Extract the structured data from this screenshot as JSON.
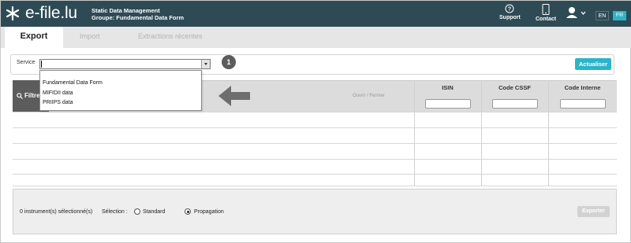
{
  "header": {
    "logo_text": "e-file.lu",
    "app_title": "Static Data Management",
    "app_group": "Groupe: Fundamental Data Form",
    "support_label": "Support",
    "contact_label": "Contact",
    "lang_en": "EN",
    "lang_fr": "FR",
    "active_language": "FR"
  },
  "tabs": [
    {
      "label": "Export",
      "active": true
    },
    {
      "label": "Import",
      "active": false
    },
    {
      "label": "Extractions récentes",
      "active": false
    }
  ],
  "service": {
    "label": "Service",
    "value": "",
    "options": [
      "Fundamental Data Form",
      "MIFIDII data",
      "PRIIPS data"
    ],
    "badge": "1",
    "refresh_label": "Actualiser"
  },
  "table": {
    "filter_label": "Filtre",
    "open_close_label": "Ouvrir / Fermer",
    "columns": [
      "ISIN",
      "Code CSSF",
      "Code Interne"
    ],
    "rows": 5
  },
  "footer": {
    "selected_text": "0 instrument(s) sélectionné(s)",
    "selection_label": "Sélection :",
    "options": [
      {
        "label": "Standard",
        "checked": false
      },
      {
        "label": "Propagation",
        "checked": true
      }
    ],
    "export_label": "Exporter"
  },
  "colors": {
    "header_bg": "#2e4a55",
    "accent": "#2bb5c7",
    "filter_bg": "#5c5c5c"
  },
  "icons": {
    "logo": "star-logo-icon",
    "support": "help-circle-icon",
    "contact": "mobile-phone-icon",
    "user": "user-icon",
    "filter": "search-icon",
    "arrow": "arrow-left-icon"
  }
}
